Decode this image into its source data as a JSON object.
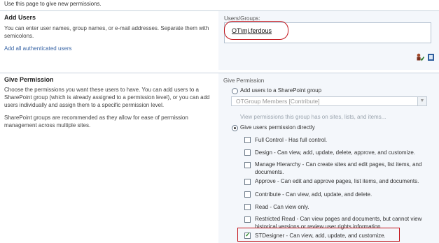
{
  "intro": "Use this page to give new permissions.",
  "add_users": {
    "title": "Add Users",
    "description": "You can enter user names, group names, or e-mail addresses. Separate them with semicolons.",
    "link": "Add all authenticated users",
    "users_label": "Users/Groups:",
    "users_value": "OT\\mj.ferdous",
    "check_names_icon": "check-names-icon",
    "browse_icon": "address-book-icon"
  },
  "give_permission": {
    "title": "Give Permission",
    "description1": "Choose the permissions you want these users to have. You can add users to a SharePoint group (which is already assigned to a permission level), or you can add users individually and assign them to a specific permission level.",
    "description2": "SharePoint groups are recommended as they allow for ease of permission management across multiple sites.",
    "panel_label": "Give Permission",
    "option_group": "Add users to a SharePoint group",
    "group_select_value": "OTGroup Members [Contribute]",
    "view_permissions_link": "View permissions this group has on sites, lists, and items...",
    "option_direct": "Give users permission directly",
    "levels": [
      {
        "label": "Full Control - Has full control.",
        "checked": false
      },
      {
        "label": "Design - Can view, add, update, delete, approve, and customize.",
        "checked": false
      },
      {
        "label": "Manage Hierarchy - Can create sites and edit pages, list items, and documents.",
        "checked": false
      },
      {
        "label": "Approve - Can edit and approve pages, list items, and documents.",
        "checked": false
      },
      {
        "label": "Contribute - Can view, add, update, and delete.",
        "checked": false
      },
      {
        "label": "Read - Can view only.",
        "checked": false
      },
      {
        "label": "Restricted Read - Can view pages and documents, but cannot view historical versions or review user rights information.",
        "checked": false
      },
      {
        "label": "STDesigner - Can view, add, update, and customize.",
        "checked": true
      }
    ]
  },
  "colors": {
    "highlight": "#c3141b",
    "link": "#3a66a6",
    "panel": "#f4f7fb"
  }
}
